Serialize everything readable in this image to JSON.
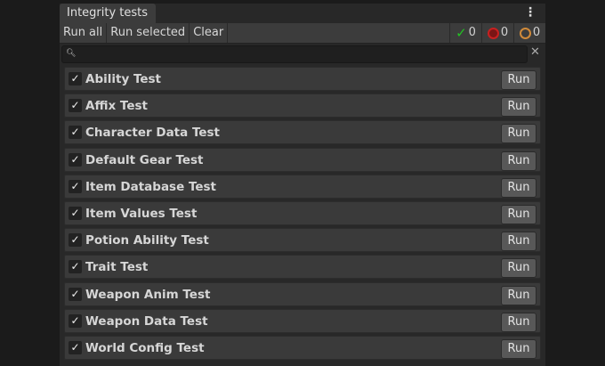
{
  "window": {
    "tab_title": "Integrity tests",
    "menu_icon": "kebab-menu-icon"
  },
  "toolbar": {
    "run_all": "Run all",
    "run_selected": "Run selected",
    "clear": "Clear",
    "passed": {
      "icon": "check-icon",
      "count": "0",
      "color": "#22c322"
    },
    "failed": {
      "icon": "error-icon",
      "count": "0",
      "color": "#c82020"
    },
    "pending": {
      "icon": "circle-icon",
      "count": "0",
      "color": "#d08a3a"
    }
  },
  "search": {
    "value": "",
    "placeholder": ""
  },
  "tests": [
    {
      "name": "Ability Test",
      "checked": true,
      "run": "Run"
    },
    {
      "name": "Affix Test",
      "checked": true,
      "run": "Run"
    },
    {
      "name": "Character Data Test",
      "checked": true,
      "run": "Run"
    },
    {
      "name": "Default Gear Test",
      "checked": true,
      "run": "Run"
    },
    {
      "name": "Item Database Test",
      "checked": true,
      "run": "Run"
    },
    {
      "name": "Item Values Test",
      "checked": true,
      "run": "Run"
    },
    {
      "name": "Potion Ability Test",
      "checked": true,
      "run": "Run"
    },
    {
      "name": "Trait Test",
      "checked": true,
      "run": "Run"
    },
    {
      "name": "Weapon Anim Test",
      "checked": true,
      "run": "Run"
    },
    {
      "name": "Weapon Data Test",
      "checked": true,
      "run": "Run"
    },
    {
      "name": "World Config Test",
      "checked": true,
      "run": "Run"
    }
  ]
}
